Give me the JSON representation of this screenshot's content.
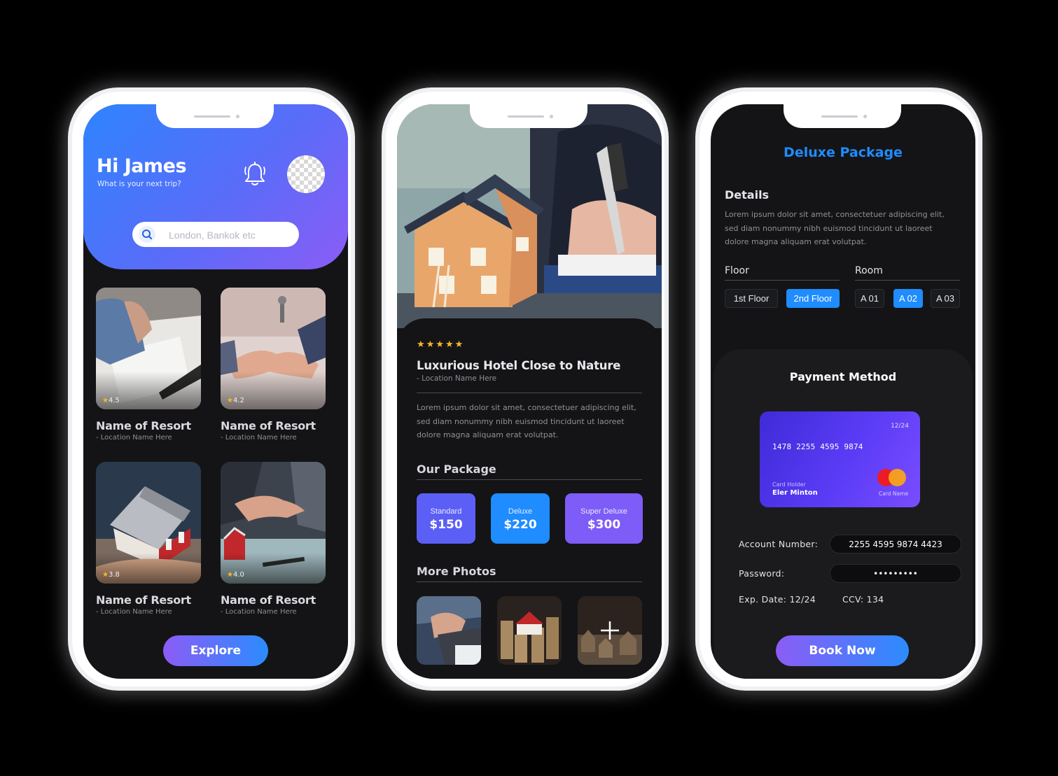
{
  "screen1": {
    "greeting": "Hi James",
    "subtitle": "What is your next trip?",
    "search_placeholder": "London, Bankok etc",
    "resorts": [
      {
        "name": "Name of Resort",
        "location": "- Location Name Here",
        "rating": "4.5"
      },
      {
        "name": "Name of Resort",
        "location": "- Location Name Here",
        "rating": "4.2"
      },
      {
        "name": "Name of Resort",
        "location": "- Location Name Here",
        "rating": "3.8"
      },
      {
        "name": "Name of Resort",
        "location": "- Location Name Here",
        "rating": "4.0"
      }
    ],
    "explore_label": "Explore"
  },
  "screen2": {
    "stars": "★★★★★",
    "title": "Luxurious Hotel Close to Nature",
    "location": "- Location Name Here",
    "description_lines": [
      "Lorem ipsum dolor sit amet, consectetuer adipiscing elit,",
      "sed diam nonummy nibh euismod tincidunt ut laoreet",
      "dolore magna aliquam erat volutpat."
    ],
    "package_heading": "Our Package",
    "packages": [
      {
        "name": "Standard",
        "price": "$150"
      },
      {
        "name": "Deluxe",
        "price": "$220"
      },
      {
        "name": "Super Deluxe",
        "price": "$300"
      }
    ],
    "photos_heading": "More Photos"
  },
  "screen3": {
    "title": "Deluxe Package",
    "details_heading": "Details",
    "details_lines": [
      "Lorem ipsum dolor sit amet, consectetuer adipiscing elit,",
      "sed diam nonummy nibh euismod tincidunt ut laoreet",
      "dolore magna aliquam erat volutpat."
    ],
    "floor_label": "Floor",
    "room_label": "Room",
    "floors": [
      "1st Floor",
      "2nd Floor"
    ],
    "rooms": [
      "A 01",
      "A 02",
      "A 03"
    ],
    "payment_heading": "Payment Method",
    "card": {
      "expiry": "12/24",
      "number": "1478 2255 4595 9874",
      "holder_label": "Card Holder",
      "holder": "Eler Minton",
      "brand_label": "Card Name"
    },
    "account_label": "Account Number:",
    "account_value": "2255 4595 9874 4423",
    "password_label": "Password:",
    "password_value": "•••••••••",
    "exp_label": "Exp. Date: 12/24",
    "ccv_label": "CCV: 134",
    "book_label": "Book Now"
  },
  "colors": {
    "accent_blue": "#1f8cff",
    "accent_purple": "#8c5cf6",
    "star": "#f7b928",
    "screen_bg": "#141416"
  }
}
